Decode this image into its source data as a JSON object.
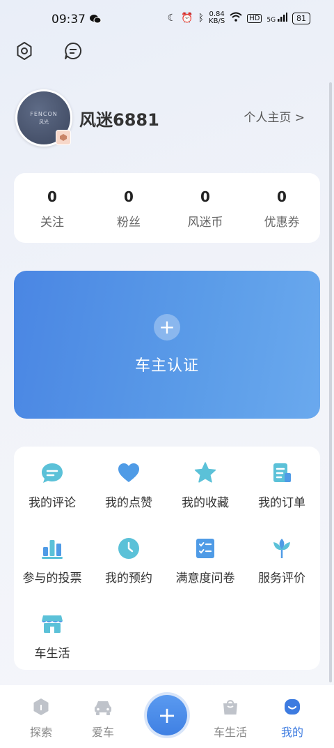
{
  "status_bar": {
    "time": "09:37",
    "net_speed_value": "0.84",
    "net_speed_unit": "KB/S",
    "hd": "HD",
    "signal": "5G",
    "battery": "81"
  },
  "profile": {
    "avatar_brand": "FENCON",
    "avatar_brand_cn": "风光",
    "username": "风迷6881",
    "homepage_link": "个人主页 >"
  },
  "stats": [
    {
      "value": "0",
      "label": "关注"
    },
    {
      "value": "0",
      "label": "粉丝"
    },
    {
      "value": "0",
      "label": "风迷币"
    },
    {
      "value": "0",
      "label": "优惠券"
    }
  ],
  "verify": {
    "label": "车主认证",
    "plus": "+"
  },
  "menu": [
    {
      "label": "我的评论",
      "icon": "comment-icon"
    },
    {
      "label": "我的点赞",
      "icon": "heart-icon"
    },
    {
      "label": "我的收藏",
      "icon": "star-icon"
    },
    {
      "label": "我的订单",
      "icon": "order-icon"
    },
    {
      "label": "参与的投票",
      "icon": "vote-icon"
    },
    {
      "label": "我的预约",
      "icon": "clock-icon"
    },
    {
      "label": "满意度问卷",
      "icon": "survey-icon"
    },
    {
      "label": "服务评价",
      "icon": "tulip-icon"
    },
    {
      "label": "车生活",
      "icon": "shop-icon"
    }
  ],
  "bottom_nav": [
    {
      "label": "探索",
      "icon": "explore-icon"
    },
    {
      "label": "爱车",
      "icon": "car-icon"
    },
    {
      "label": "车生活",
      "icon": "bag-icon"
    },
    {
      "label": "我的",
      "icon": "profile-icon"
    }
  ],
  "nav_plus": "+",
  "colors": {
    "accent": "#3d7be0",
    "icon_teal": "#5bc1d8",
    "card_blue": "#4a86e3"
  }
}
